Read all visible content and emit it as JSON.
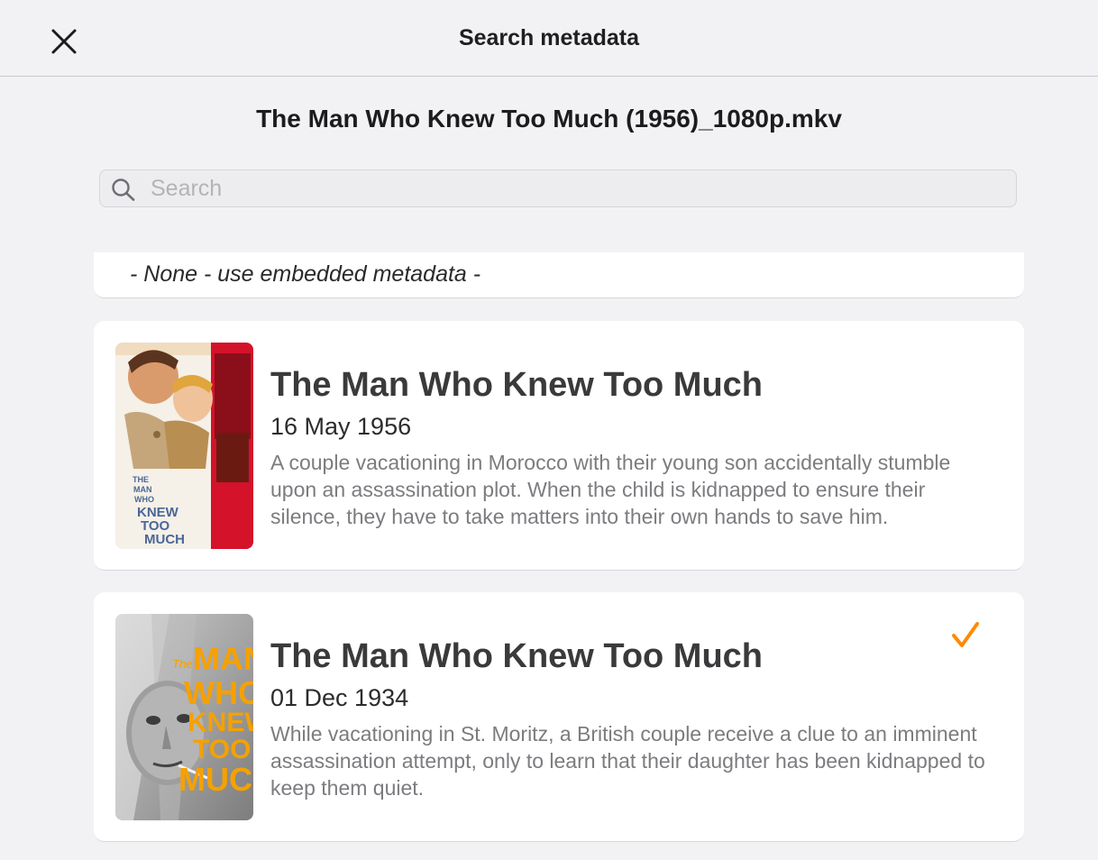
{
  "header": {
    "title": "Search metadata",
    "close_icon": "close-icon"
  },
  "filename": "The Man Who Knew Too Much (1956)_1080p.mkv",
  "search": {
    "placeholder": "Search",
    "value": "",
    "icon": "search-icon"
  },
  "none_option": {
    "label": "- None - use embedded metadata -"
  },
  "results": [
    {
      "title": "The Man Who Knew Too Much",
      "date": "16 May 1956",
      "description": "A couple vacationing in Morocco with their young son accidentally stumble upon an assassination plot. When the child is kidnapped to ensure their silence, they have to take matters into their own hands to save him.",
      "poster_text": [
        "THE",
        "MAN",
        "WHO",
        "KNEW",
        "TOO",
        "MUCH"
      ],
      "selected": false
    },
    {
      "title": "The Man Who Knew Too Much",
      "date": "01 Dec 1934",
      "description": "While vacationing in St. Moritz, a British couple receive a clue to an imminent assassination attempt, only to learn that their daughter has been kidnapped to keep them quiet.",
      "poster_text": [
        "The",
        "MAN",
        "WHO",
        "KNEW",
        "TOO",
        "MUCH"
      ],
      "selected": true
    }
  ],
  "colors": {
    "accent": "#ff8a00",
    "background": "#f2f2f4",
    "card": "#ffffff",
    "poster_red": "#d4122a",
    "poster_title_blue": "#4a6796",
    "poster_orange": "#f5a100"
  }
}
